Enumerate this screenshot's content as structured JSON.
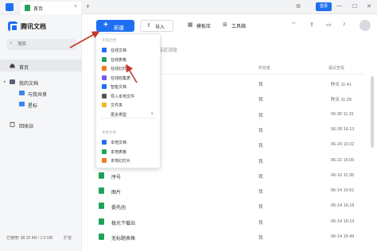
{
  "titlebar": {
    "tab_label": "首页",
    "tab_close": "×",
    "new_tab": "+",
    "login_label": "登录",
    "controls": [
      "⚙",
      "—",
      "☐",
      "✕"
    ]
  },
  "sidebar": {
    "brand": "腾讯文档",
    "search_placeholder": "搜索",
    "nav": [
      {
        "label": "首页",
        "icon": "home-icon"
      },
      {
        "label": "我的文档",
        "icon": "folder-icon"
      },
      {
        "label": "与我共享",
        "icon": "share-folder-icon"
      },
      {
        "label": "星标",
        "icon": "star-folder-icon"
      },
      {
        "label": "回收站",
        "icon": "trash-icon"
      }
    ],
    "storage": "已使用: 38.15 KB / 1.0 GB",
    "expand": "扩容"
  },
  "toolbar": {
    "new_label": "新建",
    "import_label": "导入",
    "template_label": "模板库",
    "tools_label": "工具箱"
  },
  "list": {
    "title": "最近浏览",
    "columns": {
      "owner": "所有者",
      "time": "最近查看"
    },
    "rows": [
      {
        "name": "",
        "owner": "我",
        "time": "昨天 11:41",
        "color": "#1fa35a"
      },
      {
        "name": "",
        "owner": "我",
        "time": "昨天 11:29",
        "color": "#1fa35a"
      },
      {
        "name": "",
        "owner": "我",
        "time": "06-30 11:31",
        "color": "#1fa35a"
      },
      {
        "name": "",
        "owner": "我",
        "time": "06-28 16:13",
        "color": "#1fa35a"
      },
      {
        "name": "",
        "owner": "我",
        "time": "06-24 10:22",
        "color": "#1fa35a"
      },
      {
        "name": "",
        "owner": "我",
        "time": "06-22 15:06",
        "color": "#1fa35a"
      },
      {
        "name": "序号",
        "owner": "我",
        "time": "06-16 11:35",
        "color": "#1fa35a"
      },
      {
        "name": "图片",
        "owner": "我",
        "time": "06-14 16:51",
        "color": "#1fa35a"
      },
      {
        "name": "委托函",
        "owner": "我",
        "time": "06-14 16:18",
        "color": "#1fa35a"
      },
      {
        "name": "极光下载站",
        "owner": "我",
        "time": "06-14 16:14",
        "color": "#1fa35a"
      },
      {
        "name": "无标题表格",
        "owner": "我",
        "time": "06-14 15:49",
        "color": "#1fa35a"
      }
    ]
  },
  "dropdown": {
    "section_online": "在线文档",
    "online_items": [
      {
        "label": "在线文档",
        "color": "#1f6ff2"
      },
      {
        "label": "在线表格",
        "color": "#1fa35a"
      },
      {
        "label": "在线幻灯片",
        "color": "#f07a22"
      },
      {
        "label": "在线收集表",
        "color": "#7b57e8"
      },
      {
        "label": "智能文档",
        "color": "#1f6ff2"
      },
      {
        "label": "导入本地文件",
        "color": "#555555"
      },
      {
        "label": "文件夹",
        "color": "#f5b82e"
      },
      {
        "label": "更多类型",
        "color": ""
      }
    ],
    "more_chevron": "▸",
    "section_local": "本地文件",
    "local_items": [
      {
        "label": "本地文档",
        "color": "#1f6ff2"
      },
      {
        "label": "本地表格",
        "color": "#1fa35a"
      },
      {
        "label": "本地幻灯片",
        "color": "#f07a22"
      }
    ]
  },
  "colors": {
    "accent": "#1f6ff2",
    "sheet": "#1fa35a",
    "annotation": "#c0392b"
  }
}
